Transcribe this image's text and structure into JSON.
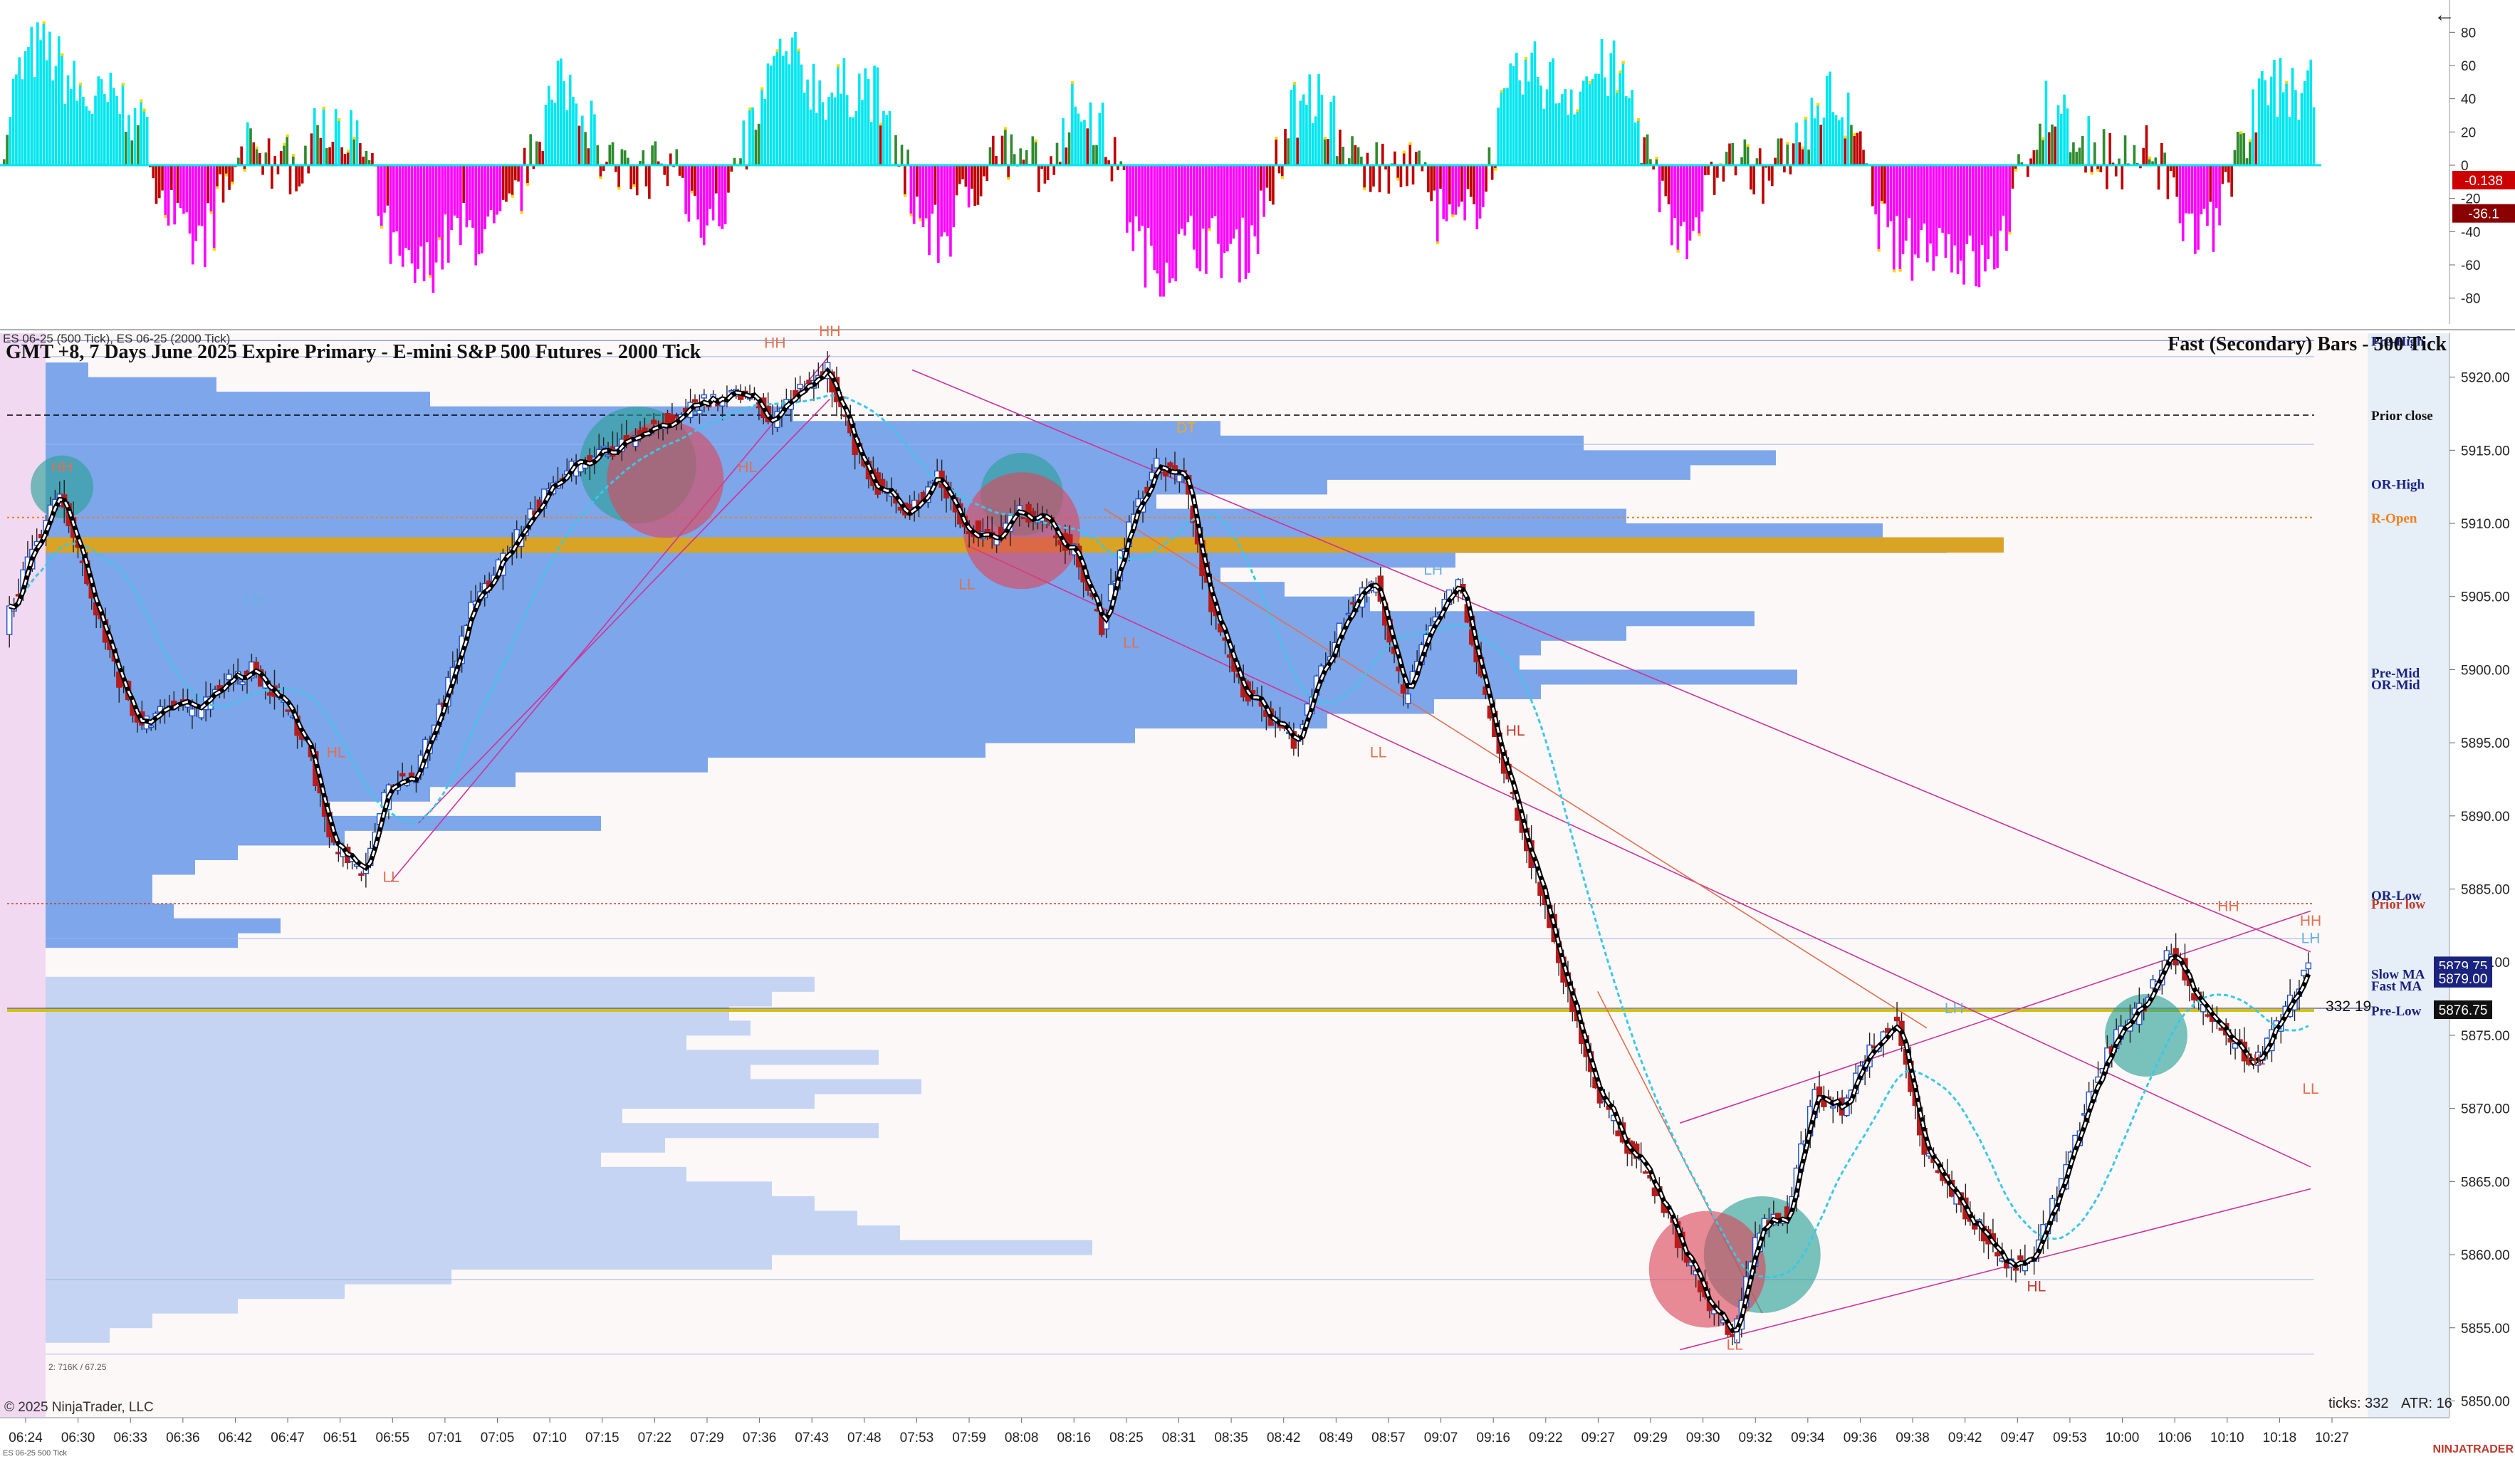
{
  "chart_data": [
    {
      "type": "histogram-oscillator",
      "panel": "oscillator",
      "y_ticks": [
        80,
        60,
        40,
        20,
        0,
        -20,
        -40,
        -60,
        -80
      ],
      "ylim": [
        -90,
        90
      ],
      "value_badges": [
        {
          "text": "-0.138",
          "value": -9,
          "color": "#cc0000"
        },
        {
          "text": "-36.1",
          "value": -29,
          "color": "#8b0000"
        }
      ],
      "series_colors": {
        "positive": "#00e5ee",
        "negative": "#ff00ff",
        "dark": "#c00000",
        "green": "#2e8b2e",
        "yellow": "#ffd700"
      }
    },
    {
      "type": "candlestick",
      "panel": "price",
      "title": "GMT +8, 7 Days June 2025 Expire Primary  - E-mini S&P 500 Futures - 2000 Tick",
      "instrument_caption": "ES 06-25 (500 Tick), ES 06-25 (2000 Tick)",
      "secondary_title": "Fast (Secondary) Bars - 500 Tick",
      "ylim": [
        5849,
        5923
      ],
      "y_ticks": [
        5920,
        5915,
        5910,
        5905,
        5900,
        5895,
        5890,
        5885,
        5880,
        5875,
        5870,
        5865,
        5860,
        5855,
        5850
      ],
      "y_tick_labels": [
        "5920.00",
        "5915.00",
        "5910.00",
        "5905.00",
        "5900.00",
        "5895.00",
        "5890.00",
        "5885.00",
        "5880.00",
        "5875.00",
        "5870.00",
        "5865.00",
        "5860.00",
        "5855.00",
        "5850.00"
      ],
      "x_ticks": [
        "06:24",
        "06:30",
        "06:33",
        "06:36",
        "06:42",
        "06:47",
        "06:51",
        "06:55",
        "07:01",
        "07:05",
        "07:10",
        "07:15",
        "07:22",
        "07:29",
        "07:36",
        "07:43",
        "07:48",
        "07:53",
        "07:59",
        "08:08",
        "08:16",
        "08:25",
        "08:31",
        "08:35",
        "08:42",
        "08:49",
        "08:57",
        "09:07",
        "09:16",
        "09:22",
        "09:27",
        "09:29",
        "09:30",
        "09:32",
        "09:34",
        "09:36",
        "09:38",
        "09:42",
        "09:47",
        "09:53",
        "10:00",
        "10:06",
        "10:10",
        "10:18",
        "10:27"
      ],
      "price_path": [
        5903,
        5908,
        5912,
        5906,
        5900,
        5896,
        5898,
        5897,
        5899,
        5900,
        5898,
        5895,
        5888,
        5886,
        5892,
        5893,
        5898,
        5904,
        5907,
        5910,
        5913,
        5914,
        5915,
        5916,
        5917,
        5918,
        5918.5,
        5919,
        5917,
        5919.5,
        5920.5,
        5915,
        5912,
        5911,
        5913,
        5910,
        5909,
        5911,
        5910,
        5908,
        5903,
        5910,
        5914,
        5913,
        5904,
        5899,
        5897,
        5895,
        5900,
        5904,
        5906,
        5898,
        5903,
        5906,
        5898,
        5891,
        5885,
        5878,
        5871,
        5868,
        5865,
        5861,
        5857,
        5854,
        5862,
        5863,
        5871,
        5870,
        5874,
        5876,
        5867,
        5864,
        5862,
        5859,
        5860,
        5865,
        5871,
        5875,
        5877,
        5881,
        5877,
        5875,
        5873,
        5876,
        5880
      ],
      "swing_labels": [
        {
          "text": "HH",
          "idx": 2,
          "price": 5913.5,
          "color": "#e07050"
        },
        {
          "text": "HL",
          "idx": 12,
          "price": 5894,
          "color": "#e07050"
        },
        {
          "text": "LH",
          "idx": 9,
          "price": 5904.5,
          "color": "#6ab0e0"
        },
        {
          "text": "LL",
          "idx": 14,
          "price": 5885.5,
          "color": "#e07050"
        },
        {
          "text": "HH",
          "idx": 28,
          "price": 5922,
          "color": "#e07050"
        },
        {
          "text": "HH",
          "idx": 30,
          "price": 5922.8,
          "color": "#e07050"
        },
        {
          "text": "HL",
          "idx": 27,
          "price": 5913.5,
          "color": "#e07050"
        },
        {
          "text": "LL",
          "idx": 35,
          "price": 5905.5,
          "color": "#e07050"
        },
        {
          "text": "DT",
          "idx": 43,
          "price": 5916.2,
          "color": "#f5a623"
        },
        {
          "text": "LL",
          "idx": 41,
          "price": 5901.5,
          "color": "#e07050"
        },
        {
          "text": "LH",
          "idx": 52,
          "price": 5906.5,
          "color": "#6ab0e0"
        },
        {
          "text": "LL",
          "idx": 50,
          "price": 5894,
          "color": "#e07050"
        },
        {
          "text": "HL",
          "idx": 55,
          "price": 5895.5,
          "color": "#c0392b"
        },
        {
          "text": "LH",
          "idx": 71,
          "price": 5876.5,
          "color": "#6ab0e0"
        },
        {
          "text": "LL",
          "idx": 63,
          "price": 5853.5,
          "color": "#e07050"
        },
        {
          "text": "HL",
          "idx": 74,
          "price": 5857.5,
          "color": "#c0392b"
        },
        {
          "text": "HH",
          "idx": 81,
          "price": 5883.5,
          "color": "#e07050"
        },
        {
          "text": "HL",
          "idx": 82,
          "price": 5873,
          "color": "#c0392b"
        },
        {
          "text": "HH",
          "idx": 84,
          "price": 5882.5,
          "color": "#e07050"
        },
        {
          "text": "LH",
          "idx": 84,
          "price": 5881.3,
          "color": "#6ab0e0"
        },
        {
          "text": "LL",
          "idx": 84,
          "price": 5871,
          "color": "#e07050"
        }
      ],
      "level_lines": [
        {
          "name": "Pre-High",
          "price": 5922.5,
          "color": "#1a237e",
          "style": "solid-thin"
        },
        {
          "name": "Prior close",
          "price": 5917.4,
          "color": "#000000",
          "style": "dashed"
        },
        {
          "name": "OR-High",
          "price": 5912.7,
          "color": "#1a237e",
          "style": "none"
        },
        {
          "name": "R-Open",
          "price": 5910.4,
          "color": "#f08020",
          "style": "dotted"
        },
        {
          "name": "Pre-Mid",
          "price": 5899.8,
          "color": "#1a237e",
          "style": "none"
        },
        {
          "name": "OR-Mid",
          "price": 5899.0,
          "color": "#1a237e",
          "style": "none"
        },
        {
          "name": "OR-Low",
          "price": 5884.6,
          "color": "#1a237e",
          "style": "none"
        },
        {
          "name": "Prior low",
          "price": 5884.0,
          "color": "#c0392b",
          "style": "dotted-red"
        },
        {
          "name": "Slow MA",
          "price": 5879.2,
          "color": "#1a237e",
          "style": "none"
        },
        {
          "name": "Fast MA",
          "price": 5878.4,
          "color": "#1a237e",
          "style": "none"
        },
        {
          "name": "Pre-Low",
          "price": 5876.7,
          "color": "#1a237e",
          "style": "solid-yellow"
        }
      ],
      "price_badges": [
        {
          "text": "5879.75",
          "price": 5879.75,
          "color": "#1a237e"
        },
        {
          "text": "5879.00",
          "price": 5878.9,
          "color": "#1a237e"
        },
        {
          "text": "5876.75",
          "price": 5876.75,
          "color": "#111111"
        }
      ],
      "volume_profile_top": [
        {
          "price": 5920.5,
          "value": 0.02
        },
        {
          "price": 5919.5,
          "value": 0.08
        },
        {
          "price": 5918.5,
          "value": 0.18
        },
        {
          "price": 5917.5,
          "value": 0.35
        },
        {
          "price": 5916.5,
          "value": 0.55
        },
        {
          "price": 5915.5,
          "value": 0.72
        },
        {
          "price": 5914.5,
          "value": 0.81
        },
        {
          "price": 5913.5,
          "value": 0.77
        },
        {
          "price": 5912.5,
          "value": 0.6
        },
        {
          "price": 5911.5,
          "value": 0.52
        },
        {
          "price": 5910.5,
          "value": 0.74
        },
        {
          "price": 5909.5,
          "value": 0.86
        },
        {
          "price": 5908.5,
          "value": 0.89
        },
        {
          "price": 5907.5,
          "value": 0.66
        },
        {
          "price": 5906.5,
          "value": 0.55
        },
        {
          "price": 5905.5,
          "value": 0.58
        },
        {
          "price": 5904.5,
          "value": 0.62
        },
        {
          "price": 5903.5,
          "value": 0.8
        },
        {
          "price": 5902.5,
          "value": 0.74
        },
        {
          "price": 5901.5,
          "value": 0.7
        },
        {
          "price": 5900.5,
          "value": 0.69
        },
        {
          "price": 5899.5,
          "value": 0.82
        },
        {
          "price": 5898.5,
          "value": 0.7
        },
        {
          "price": 5897.5,
          "value": 0.65
        },
        {
          "price": 5896.5,
          "value": 0.6
        },
        {
          "price": 5895.5,
          "value": 0.51
        },
        {
          "price": 5894.5,
          "value": 0.44
        },
        {
          "price": 5893.5,
          "value": 0.31
        },
        {
          "price": 5892.5,
          "value": 0.22
        },
        {
          "price": 5891.5,
          "value": 0.18
        },
        {
          "price": 5890.5,
          "value": 0.13
        },
        {
          "price": 5889.5,
          "value": 0.26
        },
        {
          "price": 5888.5,
          "value": 0.14
        },
        {
          "price": 5887.5,
          "value": 0.09
        },
        {
          "price": 5886.5,
          "value": 0.07
        },
        {
          "price": 5885.5,
          "value": 0.05
        },
        {
          "price": 5884.5,
          "value": 0.05
        },
        {
          "price": 5883.5,
          "value": 0.06
        },
        {
          "price": 5882.5,
          "value": 0.11
        },
        {
          "price": 5881.5,
          "value": 0.09
        }
      ],
      "volume_profile_bottom": [
        {
          "price": 5878.5,
          "value": 0.36
        },
        {
          "price": 5877.5,
          "value": 0.34
        },
        {
          "price": 5876.5,
          "value": 0.32
        },
        {
          "price": 5875.5,
          "value": 0.33
        },
        {
          "price": 5874.5,
          "value": 0.3
        },
        {
          "price": 5873.5,
          "value": 0.39
        },
        {
          "price": 5872.5,
          "value": 0.33
        },
        {
          "price": 5871.5,
          "value": 0.41
        },
        {
          "price": 5870.5,
          "value": 0.36
        },
        {
          "price": 5869.5,
          "value": 0.27
        },
        {
          "price": 5868.5,
          "value": 0.39
        },
        {
          "price": 5867.5,
          "value": 0.29
        },
        {
          "price": 5866.5,
          "value": 0.26
        },
        {
          "price": 5865.5,
          "value": 0.3
        },
        {
          "price": 5864.5,
          "value": 0.34
        },
        {
          "price": 5863.5,
          "value": 0.36
        },
        {
          "price": 5862.5,
          "value": 0.38
        },
        {
          "price": 5861.5,
          "value": 0.4
        },
        {
          "price": 5860.5,
          "value": 0.49
        },
        {
          "price": 5859.5,
          "value": 0.34
        },
        {
          "price": 5858.5,
          "value": 0.19
        },
        {
          "price": 5857.5,
          "value": 0.14
        },
        {
          "price": 5856.5,
          "value": 0.09
        },
        {
          "price": 5855.5,
          "value": 0.05
        },
        {
          "price": 5854.5,
          "value": 0.03
        }
      ],
      "poc_price": 5908.5,
      "circles": [
        {
          "idx": 2,
          "price": 5912.5,
          "size": "small",
          "color": "teal"
        },
        {
          "idx": 23,
          "price": 5914,
          "size": "large",
          "color": "teal"
        },
        {
          "idx": 24,
          "price": 5913,
          "size": "large",
          "color": "red"
        },
        {
          "idx": 37,
          "price": 5912,
          "size": "medium",
          "color": "teal"
        },
        {
          "idx": 37,
          "price": 5909.5,
          "size": "large",
          "color": "red"
        },
        {
          "idx": 64,
          "price": 5860,
          "size": "large",
          "color": "teal"
        },
        {
          "idx": 62,
          "price": 5859,
          "size": "large",
          "color": "red"
        },
        {
          "idx": 78,
          "price": 5875,
          "size": "medium",
          "color": "teal"
        }
      ]
    }
  ],
  "footer": {
    "copyright": "© 2025 NinjaTrader, LLC",
    "ticks": "ticks: 332",
    "atr": "ATR: 16",
    "brand": "NINJATRADER",
    "bottom_caption": "ES 06-25 500 Tick",
    "tiny_caption": "2: 716K / 67.25",
    "counter": "332  19"
  },
  "back_arrow": "←"
}
